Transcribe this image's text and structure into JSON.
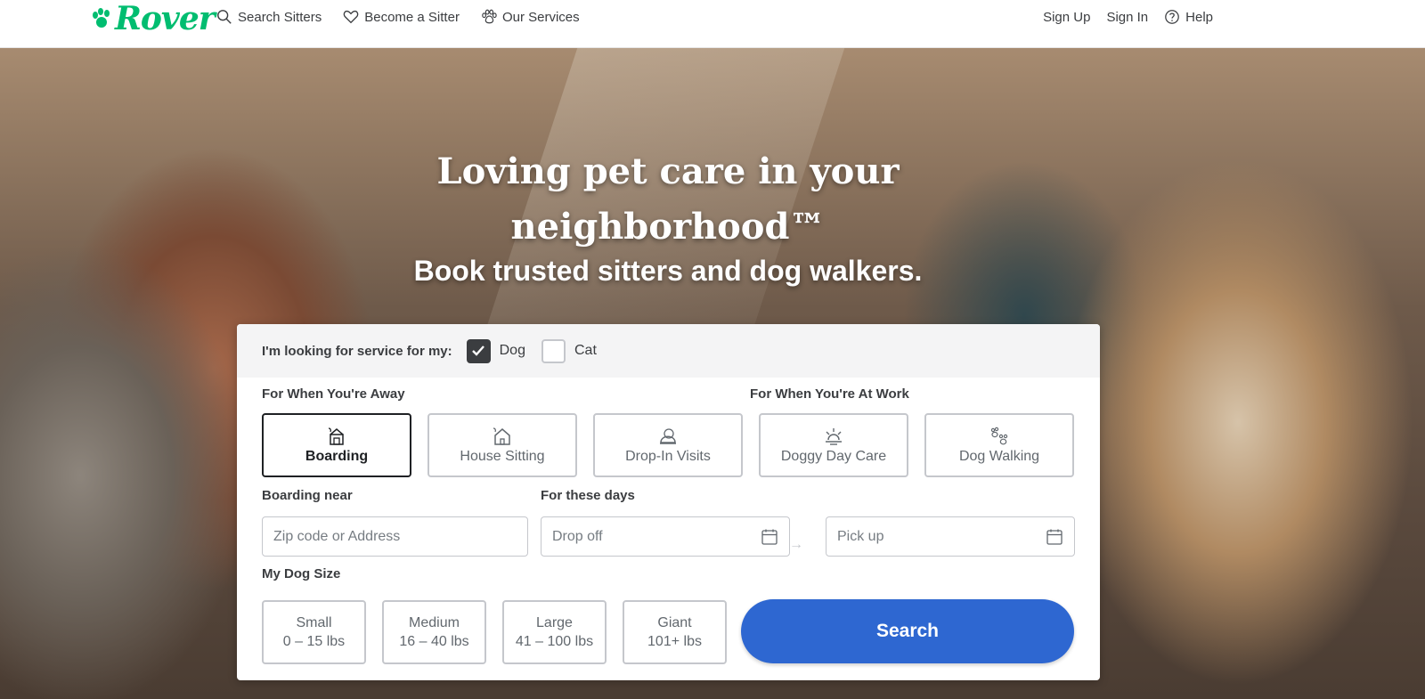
{
  "brand": {
    "name": "Rover",
    "color": "#00bd70"
  },
  "nav": {
    "left": [
      {
        "label": "Search Sitters",
        "icon": "search-icon"
      },
      {
        "label": "Become a Sitter",
        "icon": "heart-icon"
      },
      {
        "label": "Our Services",
        "icon": "paw-icon"
      }
    ],
    "sign_up": "Sign Up",
    "sign_in": "Sign In",
    "help": "Help"
  },
  "hero": {
    "title_line1": "Loving pet care in your",
    "title_line2": "neighborhood™",
    "subtitle": "Book trusted sitters and dog walkers."
  },
  "search": {
    "pet_label": "I'm looking for service for my:",
    "pets": [
      {
        "label": "Dog",
        "checked": true
      },
      {
        "label": "Cat",
        "checked": false
      }
    ],
    "away_label": "For When You're Away",
    "work_label": "For When You're At Work",
    "services": [
      {
        "label": "Boarding",
        "icon": "boarding-icon",
        "selected": true
      },
      {
        "label": "House Sitting",
        "icon": "house-icon",
        "selected": false
      },
      {
        "label": "Drop-In Visits",
        "icon": "drop-in-icon",
        "selected": false
      },
      {
        "label": "Doggy Day Care",
        "icon": "sun-icon",
        "selected": false
      },
      {
        "label": "Dog Walking",
        "icon": "paw-prints-icon",
        "selected": false
      }
    ],
    "location_label": "Boarding near",
    "location_placeholder": "Zip code or Address",
    "dates_label": "For these days",
    "drop_off_placeholder": "Drop off",
    "pick_up_placeholder": "Pick up",
    "size_label": "My Dog Size",
    "sizes": [
      {
        "name": "Small",
        "range": "0 – 15 lbs"
      },
      {
        "name": "Medium",
        "range": "16 – 40 lbs"
      },
      {
        "name": "Large",
        "range": "41 – 100 lbs"
      },
      {
        "name": "Giant",
        "range": "101+ lbs"
      }
    ],
    "search_button": "Search",
    "button_color": "#2e67d1"
  }
}
